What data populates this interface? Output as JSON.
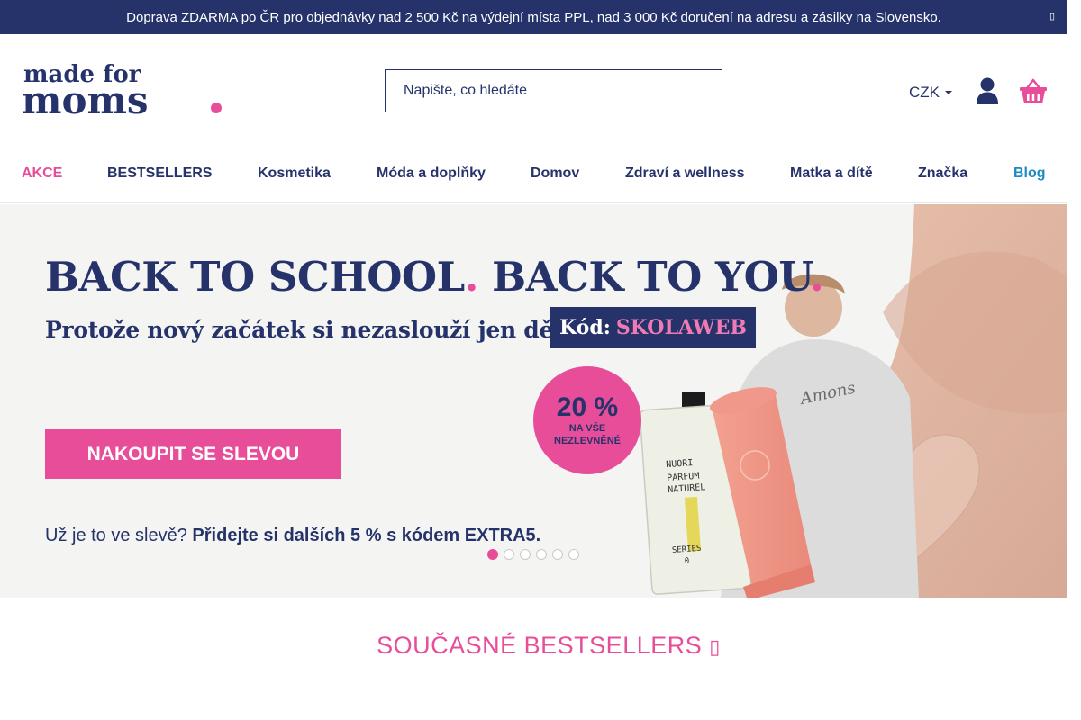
{
  "announcement": {
    "text": "Doprava ZDARMA po ČR pro objednávky nad 2 500 Kč na výdejní místa PPL, nad 3 000 Kč doručení na adresu a zásilky na Slovensko.",
    "close_icon": "close-icon"
  },
  "header": {
    "logo_text": "made for moms.",
    "search_placeholder": "Napište, co hledáte",
    "currency": "CZK",
    "icons": [
      "user-icon",
      "cart-icon"
    ]
  },
  "nav": {
    "items": [
      {
        "label": "AKCE"
      },
      {
        "label": "BESTSELLERS"
      },
      {
        "label": "Kosmetika"
      },
      {
        "label": "Móda a doplňky"
      },
      {
        "label": "Domov"
      },
      {
        "label": "Zdraví a wellness"
      },
      {
        "label": "Matka a dítě"
      },
      {
        "label": "Značka"
      },
      {
        "label": "Blog"
      }
    ]
  },
  "hero": {
    "headline_a": "BACK TO SCHOOL",
    "headline_b": "BACK TO YOU",
    "subheadline": "Protože nový začátek si nezaslouží jen děti.",
    "code_label": "Kód:",
    "code_value": "SKOLAWEB",
    "badge_percent": "20 %",
    "badge_text_1": "NA VŠE",
    "badge_text_2": "NEZLEVNĚNÉ",
    "cta": "NAKOUPIT SE SLEVOU",
    "extra_lead": "Už je to ve slevě?",
    "extra_bold": "Přidejte si dalších 5 % s kódem EXTRA5.",
    "bottle_brand": "NUORI",
    "bottle_line1": "PARFUM",
    "bottle_line2": "NATUREL",
    "bottle_line3": "SERIES",
    "bottle_line4": "0",
    "carousel_count": 6,
    "carousel_active": 1
  },
  "section": {
    "title": "SOUČASNÉ BESTSELLERS",
    "arrow_icon": "arrow-right-icon"
  },
  "colors": {
    "navy": "#26336b",
    "pink": "#e84d99",
    "blue": "#1e8ac3"
  }
}
